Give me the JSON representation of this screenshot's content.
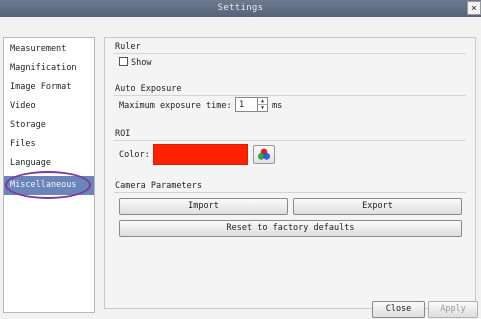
{
  "window": {
    "title": "Settings",
    "close_glyph": "×"
  },
  "sidebar": {
    "items": [
      {
        "label": "Measurement"
      },
      {
        "label": "Magnification"
      },
      {
        "label": "Image Format"
      },
      {
        "label": "Video"
      },
      {
        "label": "Storage"
      },
      {
        "label": "Files"
      },
      {
        "label": "Language"
      },
      {
        "label": "Miscellaneous",
        "selected": true
      }
    ]
  },
  "ruler": {
    "title": "Ruler",
    "show_label": "Show",
    "show_checked": false
  },
  "auto_exposure": {
    "title": "Auto Exposure",
    "max_label": "Maximum exposure time:",
    "max_value": "1",
    "unit": "ms"
  },
  "roi": {
    "title": "ROI",
    "color_label": "Color:",
    "color_value": "#ff2000"
  },
  "camera": {
    "title": "Camera Parameters",
    "import_label": "Import",
    "export_label": "Export",
    "reset_label": "Reset to factory defaults"
  },
  "footer": {
    "close_label": "Close",
    "apply_label": "Apply"
  },
  "colors": {
    "selection": "#6a86b8",
    "annotation": "#7a3aa8",
    "roi_color": "#ff2000",
    "title_bar": "#5f6c82"
  },
  "icons": {
    "palette": "palette-icon",
    "spin_up": "spin-up-icon",
    "spin_down": "spin-down-icon"
  }
}
